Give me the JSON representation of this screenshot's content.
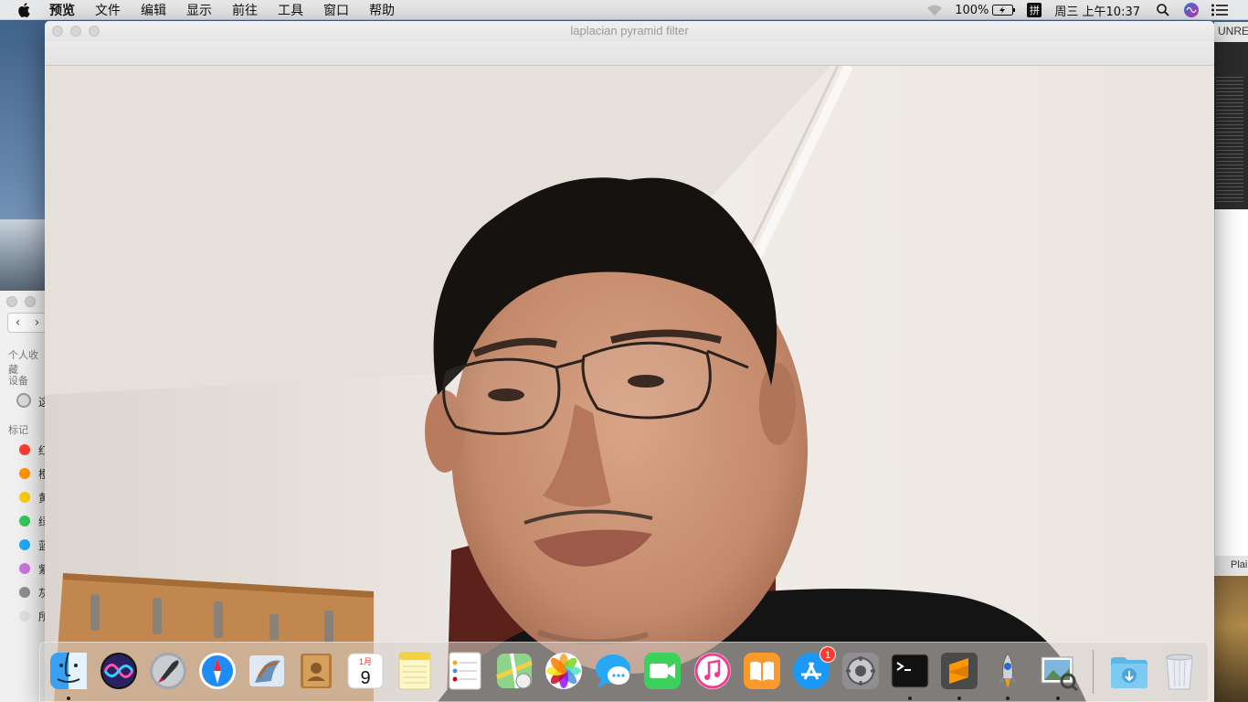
{
  "menubar": {
    "items": [
      "预览",
      "文件",
      "编辑",
      "显示",
      "前往",
      "工具",
      "窗口",
      "帮助"
    ],
    "battery": "100%",
    "input_method": "拼",
    "clock": "周三 上午10:37"
  },
  "window": {
    "title": "laplacian pyramid filter"
  },
  "background_windows": {
    "right_title": "UNRE",
    "right_bottom": "Plai",
    "finder": {
      "sections": [
        "个人收藏",
        "设备",
        "标记"
      ],
      "device_label": "这",
      "tags": [
        {
          "label": "红",
          "color": "#ff3b30"
        },
        {
          "label": "橙",
          "color": "#ff9500"
        },
        {
          "label": "黄",
          "color": "#ffcc00"
        },
        {
          "label": "绿",
          "color": "#34c759"
        },
        {
          "label": "蓝",
          "color": "#1badf8"
        },
        {
          "label": "紫",
          "color": "#cc73e1"
        },
        {
          "label": "灰",
          "color": "#8e8e93"
        },
        {
          "label": "所",
          "color": "#e0e0e0"
        }
      ]
    }
  },
  "dock": {
    "items": [
      {
        "name": "finder",
        "running": true
      },
      {
        "name": "siri",
        "running": false
      },
      {
        "name": "launchpad",
        "running": false
      },
      {
        "name": "safari",
        "running": false
      },
      {
        "name": "mail",
        "running": false
      },
      {
        "name": "contacts",
        "running": false
      },
      {
        "name": "calendar",
        "running": false,
        "month": "1月",
        "day": "9"
      },
      {
        "name": "notes",
        "running": false
      },
      {
        "name": "reminders",
        "running": false
      },
      {
        "name": "maps",
        "running": false
      },
      {
        "name": "photos",
        "running": false
      },
      {
        "name": "messages",
        "running": false
      },
      {
        "name": "facetime",
        "running": false
      },
      {
        "name": "itunes",
        "running": false
      },
      {
        "name": "ibooks",
        "running": false
      },
      {
        "name": "app-store",
        "running": false,
        "badge": "1"
      },
      {
        "name": "system-preferences",
        "running": false
      },
      {
        "name": "terminal",
        "running": true
      },
      {
        "name": "sublime-text",
        "running": true
      },
      {
        "name": "rocket",
        "running": true
      },
      {
        "name": "preview",
        "running": true
      },
      {
        "name": "downloads-folder",
        "running": false
      },
      {
        "name": "trash",
        "running": false
      }
    ]
  },
  "colors": {
    "accent": "#1a82fb",
    "badge": "#ff3b30"
  }
}
